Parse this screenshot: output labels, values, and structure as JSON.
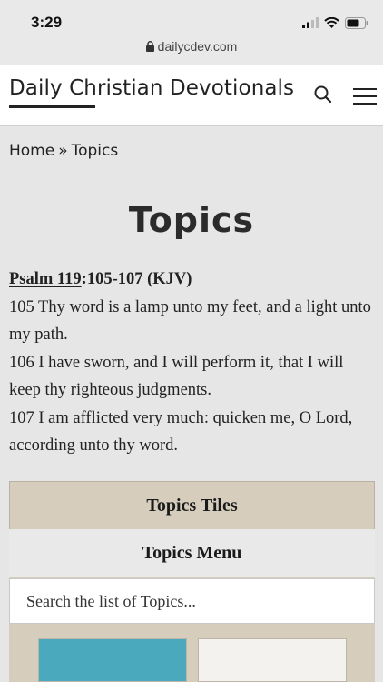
{
  "status": {
    "time": "3:29",
    "url": "dailycdev.com"
  },
  "header": {
    "site_title": "Daily Christian Devotionals"
  },
  "breadcrumb": {
    "home": "Home",
    "separator": "»",
    "current": "Topics"
  },
  "page_title": "Topics",
  "scripture": {
    "book_link": "Psalm 119",
    "reference_rest": ":105-107 (KJV)",
    "verses": [
      "105 Thy word is a lamp unto my feet, and a light unto my path.",
      "106 I have sworn, and I will perform it, that I will keep thy righteous judgments.",
      "107 I am afflicted very much: quicken me, O Lord, according unto thy word."
    ]
  },
  "topics_widget": {
    "tiles_label": "Topics Tiles",
    "menu_label": "Topics Menu",
    "search_placeholder": "Search the list of Topics..."
  },
  "colors": {
    "panel": "#d6cdbd",
    "tile_teal": "#4aa9bd"
  }
}
